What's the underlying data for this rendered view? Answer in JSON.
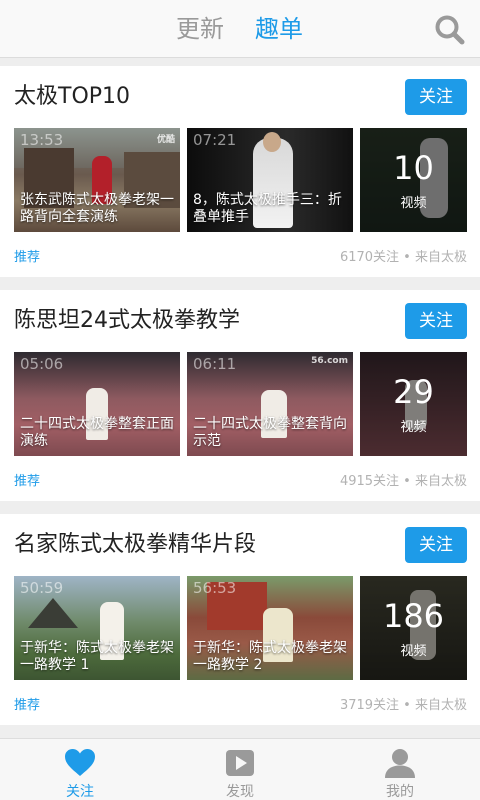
{
  "header": {
    "tabs": [
      {
        "label": "更新",
        "active": false
      },
      {
        "label": "趣单",
        "active": true
      }
    ],
    "search_icon": "search-icon"
  },
  "cards": [
    {
      "title": "太极TOP10",
      "follow_label": "关注",
      "videos": [
        {
          "duration": "13:53",
          "caption": "张东武陈式太极拳老架一路背向全套演练",
          "logo": "优酷"
        },
        {
          "duration": "07:21",
          "caption": "8，陈式太极推手三：折叠单推手",
          "logo": ""
        }
      ],
      "more": {
        "count": "10",
        "unit": "视频"
      },
      "tag": "推荐",
      "meta": "6170关注 • 来自太极"
    },
    {
      "title": "陈思坦24式太极拳教学",
      "follow_label": "关注",
      "videos": [
        {
          "duration": "05:06",
          "caption": "二十四式太极拳整套正面演练",
          "logo": ""
        },
        {
          "duration": "06:11",
          "caption": "二十四式太极拳整套背向示范",
          "logo": "56.com"
        }
      ],
      "more": {
        "count": "29",
        "unit": "视频"
      },
      "tag": "推荐",
      "meta": "4915关注 • 来自太极"
    },
    {
      "title": "名家陈式太极拳精华片段",
      "follow_label": "关注",
      "videos": [
        {
          "duration": "50:59",
          "caption": "于新华：陈式太极拳老架一路教学 1",
          "logo": ""
        },
        {
          "duration": "56:53",
          "caption": "于新华：陈式太极拳老架一路教学 2",
          "logo": ""
        }
      ],
      "more": {
        "count": "186",
        "unit": "视频"
      },
      "tag": "推荐",
      "meta": "3719关注 • 来自太极"
    }
  ],
  "bottom_nav": [
    {
      "label": "关注",
      "icon": "heart-icon",
      "active": true
    },
    {
      "label": "发现",
      "icon": "play-icon",
      "active": false
    },
    {
      "label": "我的",
      "icon": "user-icon",
      "active": false
    }
  ],
  "colors": {
    "accent": "#1e9be8",
    "inactive": "#9a9a9a"
  }
}
